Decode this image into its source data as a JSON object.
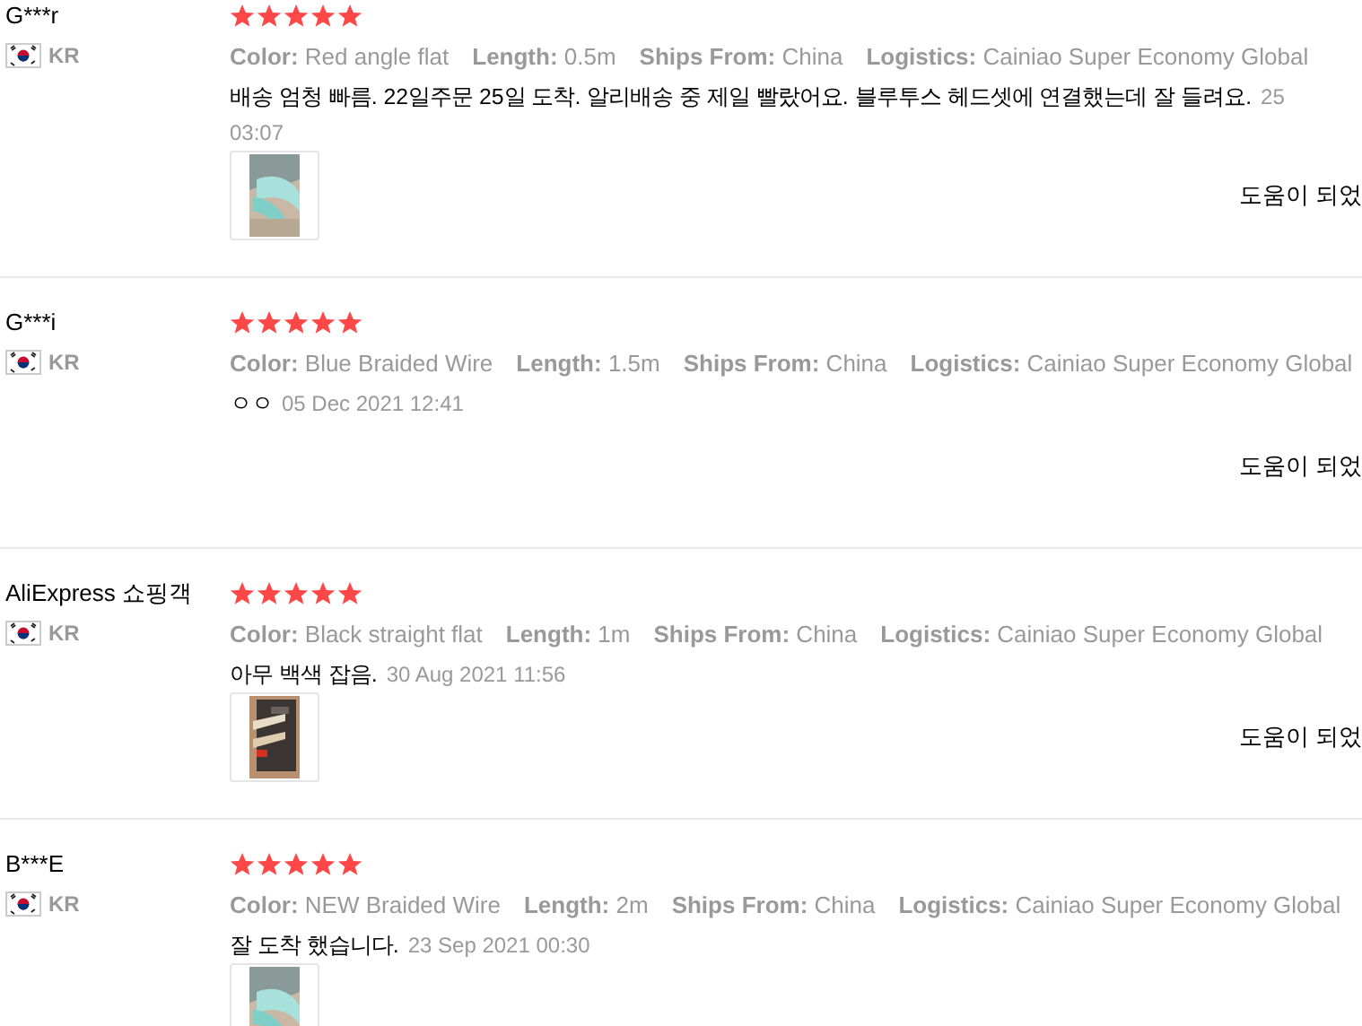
{
  "reviews": [
    {
      "name": "G***r",
      "country": "KR",
      "stars": 5,
      "meta": [
        {
          "label": "Color:",
          "value": "Red angle flat"
        },
        {
          "label": "Length:",
          "value": "0.5m"
        },
        {
          "label": "Ships From:",
          "value": "China"
        },
        {
          "label": "Logistics:",
          "value": "Cainiao Super Economy Global"
        }
      ],
      "comment": "배송 엄청 빠름. 22일주문 25일 도착. 알리배송 중 제일 빨랐어요. 블루투스 헤드셋에 연결했는데 잘 들려요.",
      "date": "25",
      "date_continued": "03:07",
      "photos": [
        {
          "kind": "picture"
        }
      ],
      "helpful": "도움이 되었"
    },
    {
      "name": "G***i",
      "country": "KR",
      "stars": 5,
      "meta": [
        {
          "label": "Color:",
          "value": "Blue Braided Wire"
        },
        {
          "label": "Length:",
          "value": "1.5m"
        },
        {
          "label": "Ships From:",
          "value": "China"
        },
        {
          "label": "Logistics:",
          "value": "Cainiao Super Economy Global"
        }
      ],
      "comment": "ㅇㅇ",
      "date": "05 Dec 2021 12:41",
      "helpful": "도움이 되었"
    },
    {
      "name": "AliExpress 쇼핑객",
      "country": "KR",
      "stars": 5,
      "meta": [
        {
          "label": "Color:",
          "value": "Black straight flat"
        },
        {
          "label": "Length:",
          "value": "1m"
        },
        {
          "label": "Ships From:",
          "value": "China"
        },
        {
          "label": "Logistics:",
          "value": "Cainiao Super Economy Global"
        }
      ],
      "comment": "아무 백색 잡음.",
      "date": "30 Aug 2021 11:56",
      "photos": [
        {
          "kind": "picture"
        }
      ],
      "helpful": "도움이 되었"
    },
    {
      "name": "B***E",
      "country": "KR",
      "stars": 5,
      "meta": [
        {
          "label": "Color:",
          "value": "NEW Braided Wire"
        },
        {
          "label": "Length:",
          "value": "2m"
        },
        {
          "label": "Ships From:",
          "value": "China"
        },
        {
          "label": "Logistics:",
          "value": "Cainiao Super Economy Global"
        }
      ],
      "comment": "잘 도착 했습니다.",
      "date": "23 Sep 2021 00:30",
      "photos": [
        {
          "kind": "picture"
        }
      ]
    }
  ]
}
